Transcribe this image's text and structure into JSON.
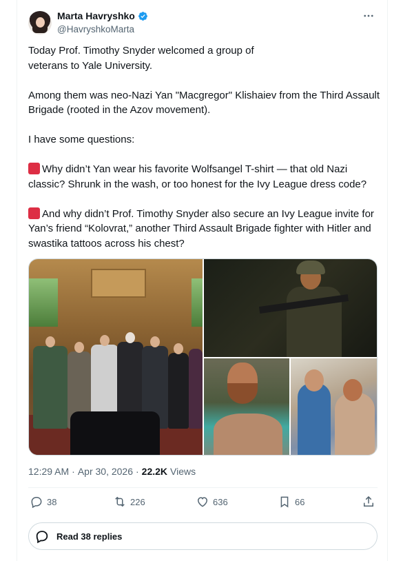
{
  "author": {
    "display_name": "Marta Havryshko",
    "handle": "@HavryshkoMarta",
    "verified_color": "#1d9bf0"
  },
  "tweet": {
    "p1_a": "Today Prof. Timothy Snyder welcomed a group of ",
    "p1_b": "veterans to Yale University.",
    "p2": "Among them was neo-Nazi Yan \"Macgregor\" Klishaiev from the Third Assault Brigade (rooted in the Azov movement).",
    "p3": "I have some questions:",
    "p4": "Why didn’t Yan wear his favorite Wolfsangel T-shirt — that old Nazi classic? Shrunk in the wash, or too honest for the Ivy League dress code?",
    "p5": "And why didn’t Prof. Timothy Snyder also secure an Ivy League invite for Yan’s friend “Kolovrat,” another Third Assault Brigade fighter with Hitler and swastika tattoos across his chest?"
  },
  "meta": {
    "time": "12:29 AM",
    "sep1": "·",
    "date": "Apr 30, 2026",
    "sep2": "·",
    "views": "22.2K",
    "views_label": "Views"
  },
  "actions": {
    "replies": "38",
    "reposts": "226",
    "likes": "636",
    "bookmarks": "66"
  },
  "read_replies": "Read 38 replies",
  "icons": {
    "reply": "reply-icon",
    "repost": "repost-icon",
    "like": "heart-icon",
    "bookmark": "bookmark-icon",
    "share": "share-icon",
    "more": "more-icon",
    "verified": "verified-icon"
  }
}
